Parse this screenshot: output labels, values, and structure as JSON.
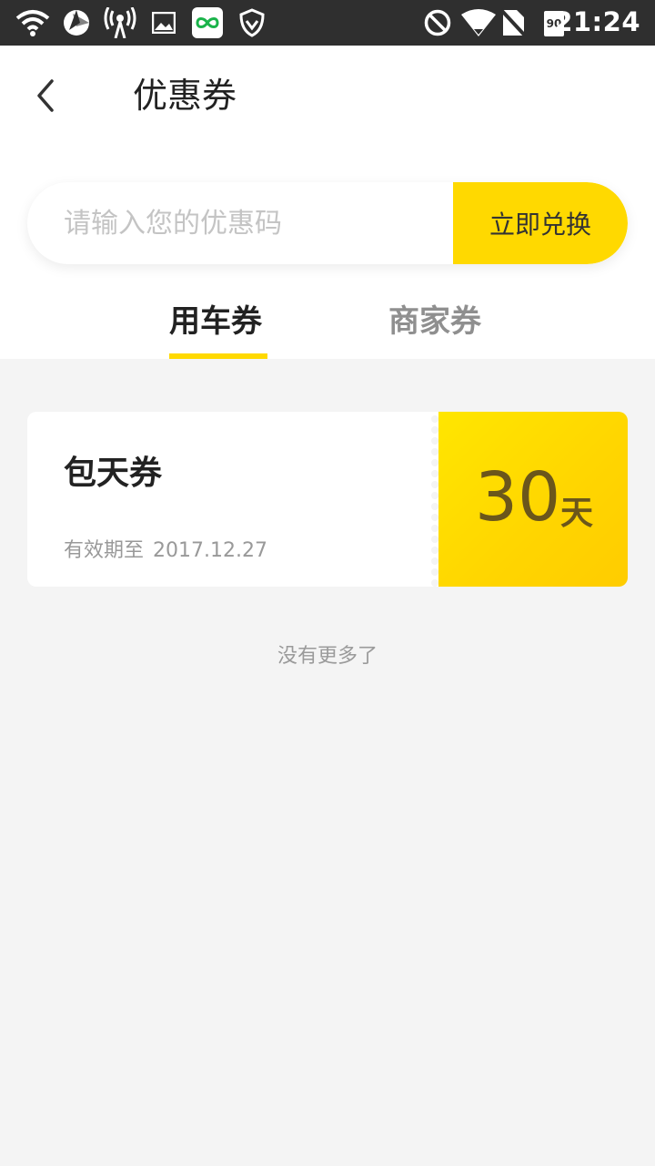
{
  "status_bar": {
    "time": "21:24",
    "battery_level": "90",
    "icons": [
      "wifi-icon",
      "aperture-icon",
      "hotspot-icon",
      "image-icon",
      "app-infinity-icon",
      "shield-icon",
      "do-not-disturb-icon",
      "wifi-signal-icon",
      "no-sim-icon",
      "battery-icon"
    ]
  },
  "header": {
    "title": "优惠券",
    "back_icon": "chevron-left-icon"
  },
  "redeem": {
    "placeholder": "请输入您的优惠码",
    "button_label": "立即兑换"
  },
  "tabs": [
    {
      "label": "用车券",
      "active": true
    },
    {
      "label": "商家券",
      "active": false
    }
  ],
  "coupons": [
    {
      "name": "包天券",
      "expiry_label": "有效期至",
      "expiry_date": "2017.12.27",
      "value": "30",
      "unit": "天"
    }
  ],
  "footer_text": "没有更多了",
  "colors": {
    "accent": "#ffd900",
    "status_bar": "#2f2f2f",
    "background": "#f4f4f4",
    "coupon_text": "#6b561b"
  }
}
